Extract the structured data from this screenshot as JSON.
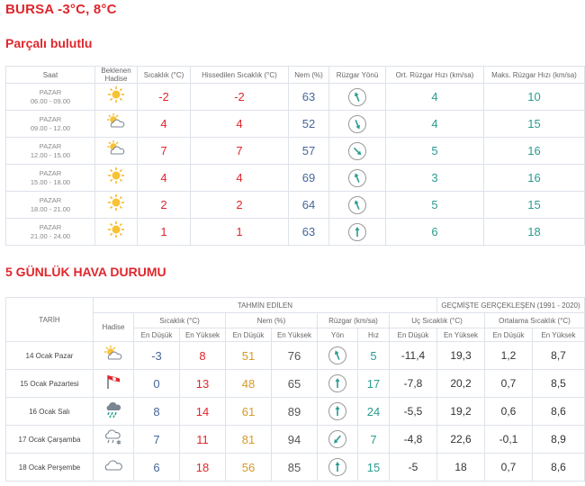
{
  "header": {
    "title": "BURSA -3°C, 8°C",
    "condition": "Parçalı bulutlu"
  },
  "hourly": {
    "columns": [
      "Saat",
      "Beklenen Hadise",
      "Sıcaklık (°C)",
      "Hissedilen Sıcaklık (°C)",
      "Nem (%)",
      "Rüzgar Yönü",
      "Ort. Rüzgar Hızı (km/sa)",
      "Maks. Rüzgar Hızı (km/sa)"
    ],
    "rows": [
      {
        "day": "PAZAR",
        "time": "06.00 - 09.00",
        "icon": "sun-icon",
        "temp": "-2",
        "feels": "-2",
        "humidity": "63",
        "wind_dir": "north-northwest",
        "avg": "4",
        "max": "10"
      },
      {
        "day": "PAZAR",
        "time": "09.00 - 12.00",
        "icon": "partly-cloudy-icon",
        "temp": "4",
        "feels": "4",
        "humidity": "52",
        "wind_dir": "south-southeast",
        "avg": "4",
        "max": "15"
      },
      {
        "day": "PAZAR",
        "time": "12.00 - 15.00",
        "icon": "partly-cloudy-icon",
        "temp": "7",
        "feels": "7",
        "humidity": "57",
        "wind_dir": "southeast",
        "avg": "5",
        "max": "16"
      },
      {
        "day": "PAZAR",
        "time": "15.00 - 18.00",
        "icon": "sun-icon",
        "temp": "4",
        "feels": "4",
        "humidity": "69",
        "wind_dir": "north-northwest",
        "avg": "3",
        "max": "16"
      },
      {
        "day": "PAZAR",
        "time": "18.00 - 21.00",
        "icon": "sun-icon",
        "temp": "2",
        "feels": "2",
        "humidity": "64",
        "wind_dir": "north-northwest",
        "avg": "5",
        "max": "15"
      },
      {
        "day": "PAZAR",
        "time": "21.00 - 24.00",
        "icon": "sun-icon",
        "temp": "1",
        "feels": "1",
        "humidity": "63",
        "wind_dir": "north",
        "avg": "6",
        "max": "18"
      }
    ]
  },
  "forecast": {
    "title": "5 GÜNLÜK HAVA DURUMU",
    "group_forecast": "TAHMİN EDİLEN",
    "group_history": "GEÇMİŞTE GERÇEKLEŞEN (1991 - 2020)",
    "col_date": "TARİH",
    "col_event": "Hadise",
    "col_temp": "Sıcaklık (°C)",
    "col_hum": "Nem (%)",
    "col_wind": "Rüzgar (km/sa)",
    "col_extreme": "Uç Sıcaklık (°C)",
    "col_avg": "Ortalama Sıcaklık (°C)",
    "lbl_low": "En Düşük",
    "lbl_high": "En Yüksek",
    "lbl_dir": "Yön",
    "lbl_speed": "Hız",
    "rows": [
      {
        "date": "14 Ocak Pazar",
        "icon": "partly-cloudy-icon",
        "tmin": "-3",
        "tmax": "8",
        "hmin": "51",
        "hmax": "76",
        "wind_dir": "north-northwest",
        "speed": "5",
        "xmin": "-11,4",
        "xmax": "19,3",
        "amin": "1,2",
        "amax": "8,7"
      },
      {
        "date": "15 Ocak Pazartesi",
        "icon": "wind-flag-icon",
        "tmin": "0",
        "tmax": "13",
        "hmin": "48",
        "hmax": "65",
        "wind_dir": "north",
        "speed": "17",
        "xmin": "-7,8",
        "xmax": "20,2",
        "amin": "0,7",
        "amax": "8,5"
      },
      {
        "date": "16 Ocak Salı",
        "icon": "rain-icon",
        "tmin": "8",
        "tmax": "14",
        "hmin": "61",
        "hmax": "89",
        "wind_dir": "north",
        "speed": "24",
        "xmin": "-5,5",
        "xmax": "19,2",
        "amin": "0,6",
        "amax": "8,6"
      },
      {
        "date": "17 Ocak Çarşamba",
        "icon": "rain-snow-icon",
        "tmin": "7",
        "tmax": "11",
        "hmin": "81",
        "hmax": "94",
        "wind_dir": "southwest",
        "speed": "7",
        "xmin": "-4,8",
        "xmax": "22,6",
        "amin": "-0,1",
        "amax": "8,9"
      },
      {
        "date": "18 Ocak Perşembe",
        "icon": "cloud-icon",
        "tmin": "6",
        "tmax": "18",
        "hmin": "56",
        "hmax": "85",
        "wind_dir": "north",
        "speed": "15",
        "xmin": "-5",
        "xmax": "18",
        "amin": "0,7",
        "amax": "8,6"
      }
    ]
  },
  "colors": {
    "accent": "#e0262c",
    "temp": "#e0262c",
    "humidity": "#46669a",
    "wind": "#2a9c90",
    "orange": "#d79a26"
  }
}
